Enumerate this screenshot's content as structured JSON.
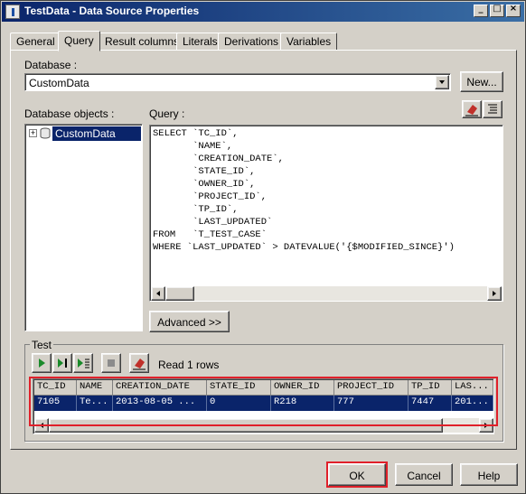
{
  "window": {
    "title": "TestData - Data Source Properties"
  },
  "titlebar_buttons": [
    {
      "glyph": "_",
      "icon": "minimize-icon"
    },
    {
      "glyph": "□",
      "icon": "maximize-icon"
    },
    {
      "glyph": "×",
      "icon": "close-icon"
    }
  ],
  "tabs": [
    "General",
    "Query",
    "Result columns",
    "Literals",
    "Derivations",
    "Variables"
  ],
  "active_tab": "Query",
  "database": {
    "label": "Database :",
    "value": "CustomData",
    "new_button": "New..."
  },
  "objects": {
    "label": "Database objects :",
    "items": [
      {
        "expand": "+",
        "name": "CustomData"
      }
    ]
  },
  "query": {
    "label": "Query :",
    "lines": [
      "SELECT `TC_ID`,",
      "       `NAME`,",
      "       `CREATION_DATE`,",
      "       `STATE_ID`,",
      "       `OWNER_ID`,",
      "       `PROJECT_ID`,",
      "       `TP_ID`,",
      "       `LAST_UPDATED`",
      "FROM   `T_TEST_CASE`",
      "WHERE `LAST_UPDATED` > DATEVALUE('{$MODIFIED_SINCE}')"
    ]
  },
  "advanced_button": "Advanced >>",
  "test": {
    "label": "Test",
    "status": "Read 1 rows",
    "columns": [
      "TC_ID",
      "NAME",
      "CREATION_DATE",
      "STATE_ID",
      "OWNER_ID",
      "PROJECT_ID",
      "TP_ID",
      "LAS..."
    ],
    "row": [
      "7105",
      "Te...",
      "2013-08-05 ...",
      "0",
      "R218",
      "777",
      "7447",
      "201..."
    ]
  },
  "footer": {
    "ok": "OK",
    "cancel": "Cancel",
    "help": "Help"
  },
  "colors": {
    "highlight_box": "#e0202a",
    "selection": "#0a246a",
    "title_gradient_start": "#0a246a"
  }
}
